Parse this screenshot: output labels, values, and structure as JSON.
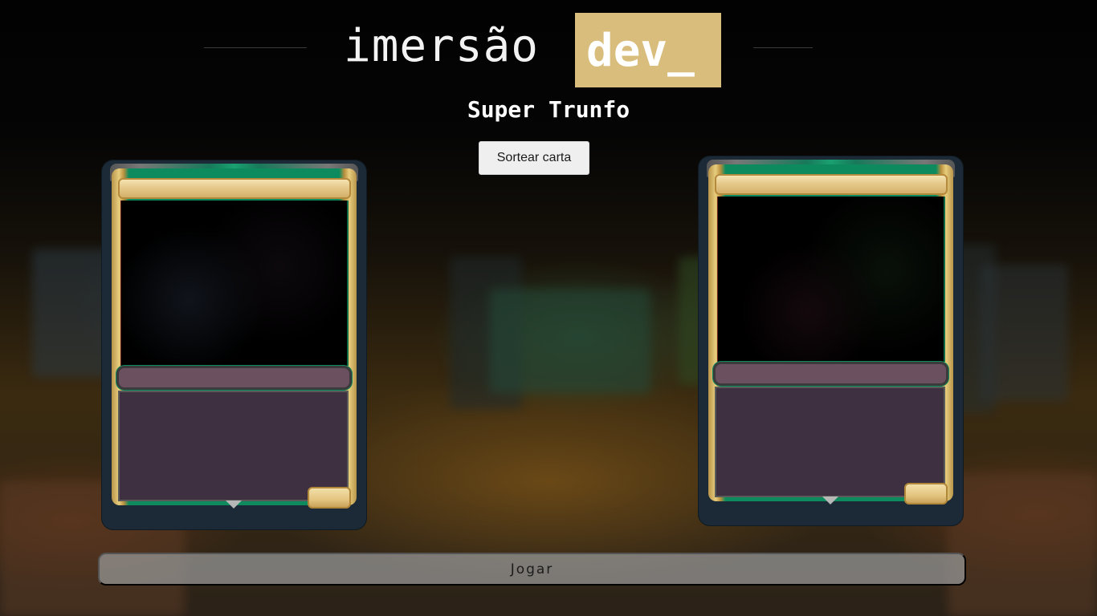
{
  "header": {
    "logo_text": "imersão",
    "logo_highlight": "dev_",
    "accent_color": "#d9bd7c"
  },
  "page": {
    "title": "Super Trunfo"
  },
  "actions": {
    "draw_card_label": "Sortear carta",
    "play_label": "Jogar"
  },
  "cards": {
    "player": {
      "name": "",
      "description": ""
    },
    "machine": {
      "name": "",
      "description": ""
    }
  },
  "colors": {
    "card_background": "#1b2a36",
    "frame_green": "#0e8b5e",
    "frame_gold": "#e6c98b",
    "text_box": "#3e3041",
    "type_bar": "#6b5060"
  }
}
